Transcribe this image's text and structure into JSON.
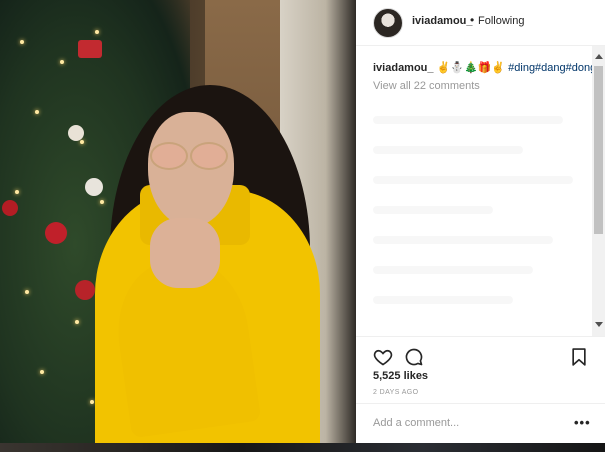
{
  "post": {
    "username": "iviadamou_",
    "separator": "•",
    "follow_status": "Following"
  },
  "caption": {
    "user": "iviadamou_",
    "text": "✌️⛄️🎄🎁✌️",
    "hashtags": "#ding#dang#dong",
    "view_all": "View all 22 comments"
  },
  "stats": {
    "likes": "5,525 likes",
    "time": "2 DAYS AGO"
  },
  "comment": {
    "placeholder": "Add a comment...",
    "more": "•••"
  },
  "icons": {
    "like": "heart-icon",
    "comment": "comment-icon",
    "save": "bookmark-icon",
    "scroll_up": "scroll-up-arrow",
    "scroll_down": "scroll-down-arrow"
  }
}
